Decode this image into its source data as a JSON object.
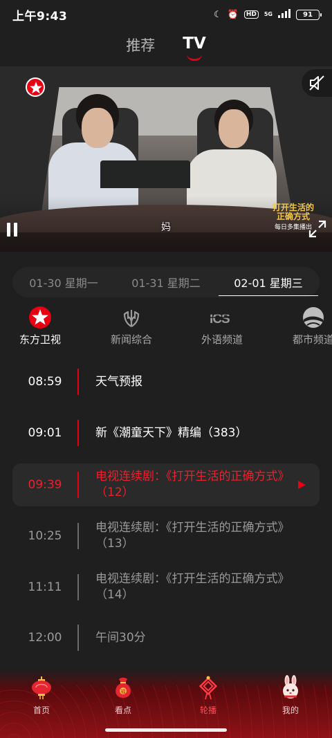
{
  "status_bar": {
    "time": "上午9:43",
    "hd": "HD",
    "network": "5G",
    "battery": "91"
  },
  "top_tabs": [
    {
      "label": "推荐",
      "active": false
    },
    {
      "label": "TV",
      "active": true
    }
  ],
  "player": {
    "subtitle": "妈",
    "watermark_title": "打开生活的正确方式",
    "watermark_sub": "每日多集播出"
  },
  "dates": [
    {
      "label": "01-30 星期一",
      "active": false
    },
    {
      "label": "01-31 星期二",
      "active": false
    },
    {
      "label": "02-01 星期三",
      "active": true
    }
  ],
  "channels": [
    {
      "name": "东方卫视",
      "icon": "dragon-tv-icon",
      "active": true
    },
    {
      "name": "新闻综合",
      "icon": "news-tv-icon",
      "active": false
    },
    {
      "name": "外语频道",
      "icon": "ics-icon",
      "active": false
    },
    {
      "name": "都市频道",
      "icon": "city-tv-icon",
      "active": false
    }
  ],
  "programs": [
    {
      "time": "08:59",
      "title": "天气预报",
      "state": "past"
    },
    {
      "time": "09:01",
      "title": "新《潮童天下》精编（383）",
      "state": "past"
    },
    {
      "time": "09:39",
      "title": "电视连续剧：《打开生活的正确方式》（12）",
      "state": "now"
    },
    {
      "time": "10:25",
      "title": "电视连续剧：《打开生活的正确方式》（13）",
      "state": "future"
    },
    {
      "time": "11:11",
      "title": "电视连续剧：《打开生活的正确方式》（14）",
      "state": "future"
    },
    {
      "time": "12:00",
      "title": "午间30分",
      "state": "future"
    }
  ],
  "bottom_nav": [
    {
      "label": "首页",
      "icon": "lantern-icon",
      "active": false
    },
    {
      "label": "看点",
      "icon": "lucky-bag-icon",
      "active": false
    },
    {
      "label": "轮播",
      "icon": "chinese-knot-icon",
      "active": true
    },
    {
      "label": "我的",
      "icon": "rabbit-icon",
      "active": false
    }
  ],
  "colors": {
    "accent": "#e60012",
    "background": "#1f1f1f"
  }
}
